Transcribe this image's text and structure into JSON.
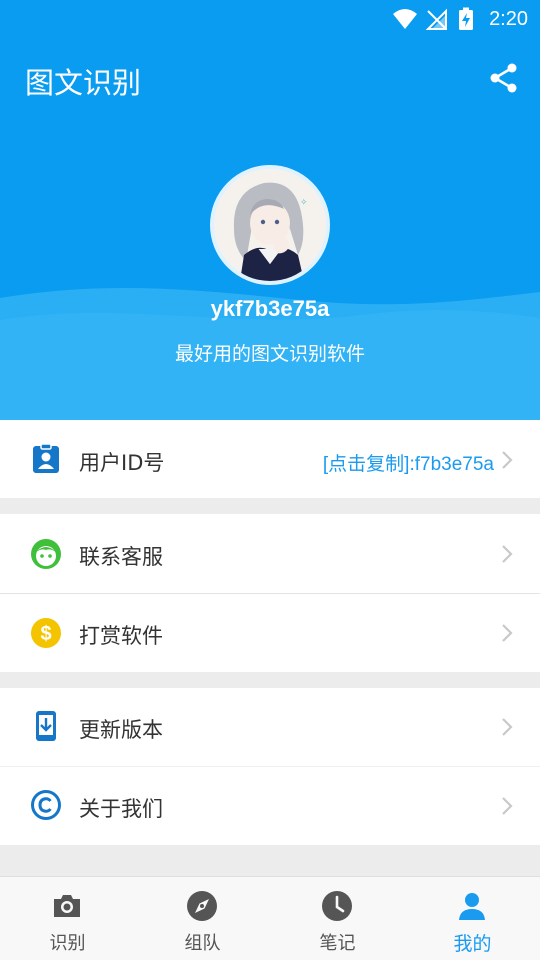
{
  "status_bar": {
    "time": "2:20"
  },
  "app_bar": {
    "title": "图文识别"
  },
  "profile": {
    "username": "ykf7b3e75a",
    "slogan": "最好用的图文识别软件"
  },
  "menu": {
    "user_id": {
      "label": "用户ID号",
      "value": "[点击复制]:f7b3e75a"
    },
    "contact": {
      "label": "联系客服"
    },
    "reward": {
      "label": "打赏软件"
    },
    "update": {
      "label": "更新版本"
    },
    "about": {
      "label": "关于我们"
    }
  },
  "bottom_nav": {
    "items": [
      {
        "label": "识别",
        "icon": "camera-icon"
      },
      {
        "label": "组队",
        "icon": "compass-icon"
      },
      {
        "label": "笔记",
        "icon": "clock-icon"
      },
      {
        "label": "我的",
        "icon": "person-icon",
        "active": true
      }
    ]
  },
  "colors": {
    "primary": "#0a9cf0",
    "accent_text": "#1a9bf0",
    "contact_icon": "#3fbf3a",
    "reward_icon": "#f5c400",
    "icon_blue": "#1677c9"
  }
}
